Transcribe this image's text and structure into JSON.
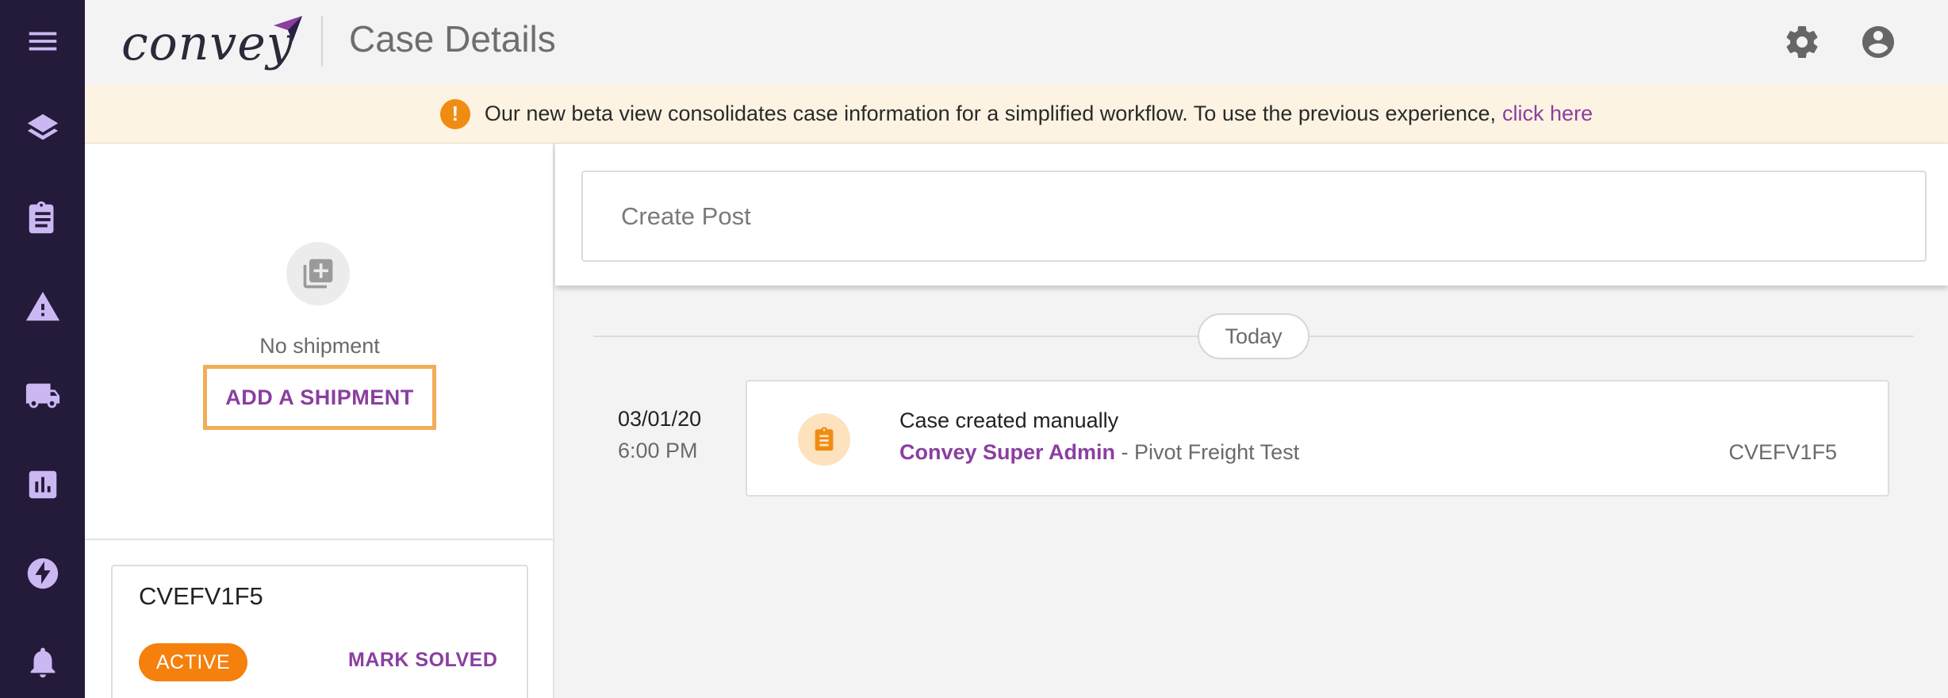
{
  "header": {
    "logo_text": "convey",
    "page_title": "Case Details"
  },
  "nav": {
    "items": [
      {
        "icon": "menu-icon"
      },
      {
        "icon": "layers-icon"
      },
      {
        "icon": "clipboard-icon"
      },
      {
        "icon": "warning-icon"
      },
      {
        "icon": "truck-icon"
      },
      {
        "icon": "chart-icon"
      },
      {
        "icon": "bolt-icon"
      },
      {
        "icon": "bell-icon"
      }
    ]
  },
  "banner": {
    "icon": "!",
    "message": "Our new beta view consolidates case information for a simplified workflow. To use the previous experience,",
    "link": "click here"
  },
  "shipment": {
    "empty_text": "No shipment",
    "add_button": "ADD A SHIPMENT"
  },
  "case": {
    "id": "CVEFV1F5",
    "status": "ACTIVE",
    "mark_solved": "MARK SOLVED"
  },
  "post": {
    "placeholder": "Create Post"
  },
  "timeline": {
    "divider": "Today",
    "entries": [
      {
        "date": "03/01/20",
        "time": "6:00 PM",
        "title": "Case created manually",
        "author": "Convey Super Admin",
        "separator": " - ",
        "org": "Pivot Freight Test",
        "reference": "CVEFV1F5"
      }
    ]
  },
  "colors": {
    "rail": "#241a3a",
    "accent_purple": "#8a3fa0",
    "accent_orange": "#f5800d",
    "banner_bg": "#fdf3e2"
  }
}
